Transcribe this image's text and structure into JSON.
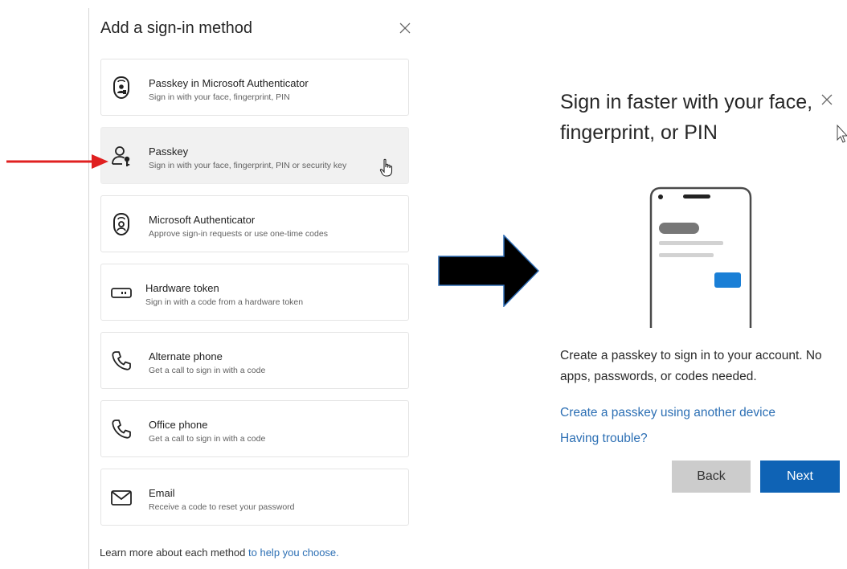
{
  "left": {
    "title": "Add a sign-in method",
    "methods": [
      {
        "title": "Passkey in Microsoft Authenticator",
        "subtitle": "Sign in with your face, fingerprint, PIN",
        "icon": "passkey-authenticator-icon"
      },
      {
        "title": "Passkey",
        "subtitle": "Sign in with your face, fingerprint, PIN or security key",
        "icon": "passkey-icon",
        "hovered": true
      },
      {
        "title": "Microsoft Authenticator",
        "subtitle": "Approve sign-in requests or use one-time codes",
        "icon": "authenticator-lock-icon"
      },
      {
        "title": "Hardware token",
        "subtitle": "Sign in with a code from a hardware token",
        "icon": "hardware-token-icon"
      },
      {
        "title": "Alternate phone",
        "subtitle": "Get a call to sign in with a code",
        "icon": "phone-icon"
      },
      {
        "title": "Office phone",
        "subtitle": "Get a call to sign in with a code",
        "icon": "phone-icon"
      },
      {
        "title": "Email",
        "subtitle": "Receive a code to reset your password",
        "icon": "mail-icon"
      }
    ],
    "footer_text": "Learn more about each method ",
    "footer_link": "to help you choose."
  },
  "right": {
    "title": "Sign in faster with your face, fingerprint, or PIN",
    "description": "Create a passkey to sign in to your account. No apps, passwords, or codes needed.",
    "link_another_device": "Create a passkey using another device",
    "link_trouble": "Having trouble?",
    "back_label": "Back",
    "next_label": "Next"
  },
  "colors": {
    "accent": "#0f63b5",
    "link": "#2c6fb4",
    "red_arrow": "#e02020",
    "hover_bg": "#f1f1f1"
  }
}
